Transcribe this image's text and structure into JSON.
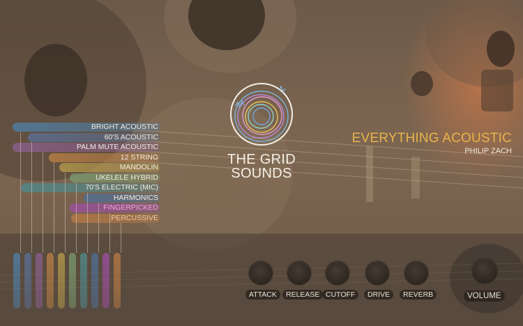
{
  "logo": {
    "line1": "THE GRID",
    "line2": "SOUNDS"
  },
  "product": {
    "title": "EVERYTHING ACOUSTIC",
    "author": "PHILIP ZACH"
  },
  "articulations": [
    {
      "label": "BRIGHT ACOUSTIC",
      "color": "#4f7fa6"
    },
    {
      "label": "60'S ACOUSTIC",
      "color": "#5b6f95"
    },
    {
      "label": "PALM MUTE ACOUSTIC",
      "color": "#8a5f8e"
    },
    {
      "label": "12 STRING",
      "color": "#b97f45"
    },
    {
      "label": "MANDOLIN",
      "color": "#b59a4c"
    },
    {
      "label": "UKELELE HYBRID",
      "color": "#7a9a6e"
    },
    {
      "label": "70'S ELECTRIC (MIC)",
      "color": "#4f8a8c"
    },
    {
      "label": "HARMONICS",
      "color": "#4f6f98"
    },
    {
      "label": "FINGERPICKED",
      "color": "#9c4fa0"
    },
    {
      "label": "PERCUSSIVE",
      "color": "#b87a45"
    }
  ],
  "selected_articulation": "FINGERPICKED",
  "strips": [
    {
      "color": "#4f7fa6"
    },
    {
      "color": "#5b6f95"
    },
    {
      "color": "#8a5f8e"
    },
    {
      "color": "#b97f45"
    },
    {
      "color": "#b59a4c"
    },
    {
      "color": "#7a9a6e"
    },
    {
      "color": "#4f8a8c"
    },
    {
      "color": "#4f6f98"
    },
    {
      "color": "#9c4fa0"
    },
    {
      "color": "#b87a45"
    }
  ],
  "knobs": [
    {
      "label": "ATTACK"
    },
    {
      "label": "RELEASE"
    },
    {
      "label": "CUTOFF"
    },
    {
      "label": "DRIVE"
    },
    {
      "label": "REVERB"
    }
  ],
  "volume": {
    "label": "VOLUME"
  }
}
